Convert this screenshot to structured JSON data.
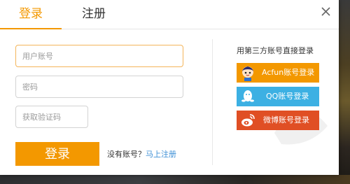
{
  "tabs": {
    "login": "登录",
    "register": "注册"
  },
  "form": {
    "account_placeholder": "用户账号",
    "password_placeholder": "密码",
    "code_placeholder": "获取验证码",
    "login_button": "登录",
    "no_account_text": "没有账号？",
    "register_link": "马上注册"
  },
  "third_party": {
    "title": "用第三方账号直接登录",
    "buttons": [
      {
        "label": "Acfun账号登录",
        "icon": "acfun-mascot-icon",
        "color": "#f39800"
      },
      {
        "label": "QQ账号登录",
        "icon": "qq-penguin-icon",
        "color": "#3cb0e3"
      },
      {
        "label": "微博账号登录",
        "icon": "weibo-icon",
        "color": "#e04f24"
      }
    ]
  },
  "colors": {
    "accent": "#f39800",
    "link": "#3d8fd6"
  }
}
